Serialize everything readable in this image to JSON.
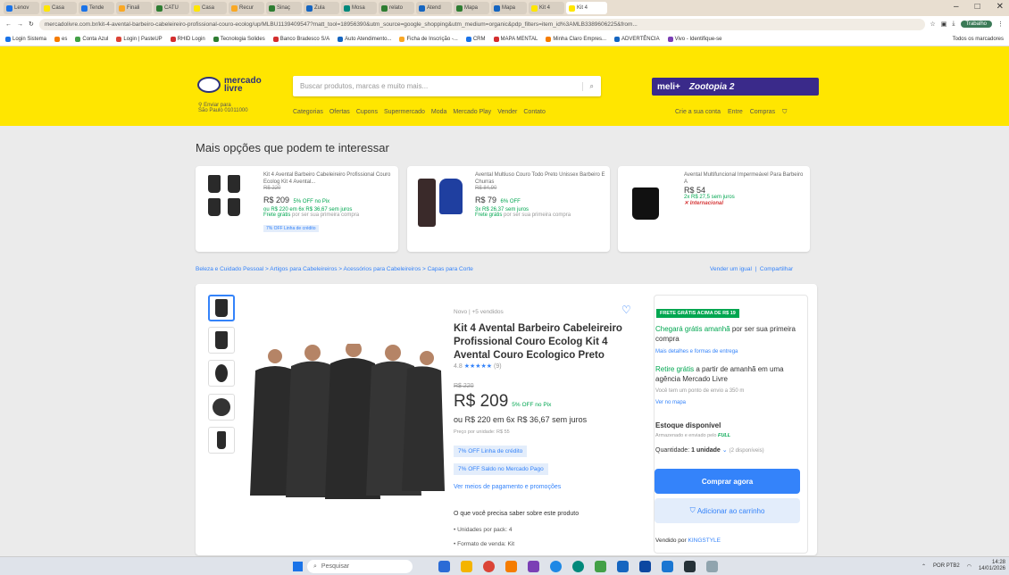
{
  "browser": {
    "tabs": [
      {
        "label": "Lenov",
        "color": "#1a73e8"
      },
      {
        "label": "Casa",
        "color": "#ffe600"
      },
      {
        "label": "Tende",
        "color": "#1a73e8"
      },
      {
        "label": "Finali",
        "color": "#f9a825"
      },
      {
        "label": "CATU",
        "color": "#2e7d32"
      },
      {
        "label": "Casa",
        "color": "#ffe600"
      },
      {
        "label": "Recur",
        "color": "#f9a825"
      },
      {
        "label": "Sinaç",
        "color": "#2e7d32"
      },
      {
        "label": "Zula",
        "color": "#1565c0"
      },
      {
        "label": "Mosa",
        "color": "#00897b"
      },
      {
        "label": "relato",
        "color": "#2e7d32"
      },
      {
        "label": "Atend",
        "color": "#1565c0"
      },
      {
        "label": "Mapa",
        "color": "#2e7d32"
      },
      {
        "label": "Mapa",
        "color": "#1565c0"
      },
      {
        "label": "Kit 4",
        "color": "#ffe600"
      },
      {
        "label": "Kit 4",
        "color": "#ffe600"
      }
    ],
    "url": "mercadolivre.com.br/kit-4-avental-barbeiro-cabeleireiro-profissional-couro-ecolog/up/MLBU1139409547?matt_tool=18956390&utm_source=google_shopping&utm_medium=organic&pdp_filters=item_id%3AMLB3389606225&from...",
    "profile": "Trabalho",
    "bookmarks": [
      "Login Sistema",
      "es",
      "Conta Azul",
      "Login | PasteUP",
      "RHID Login",
      "Tecnologia Solides",
      "Banco Bradesco S/A",
      "Auto Atendimento...",
      "Ficha de Inscrição -...",
      "CRM",
      "MAPA MENTAL",
      "Minha Claro Empres...",
      "ADVERTÊNCIA",
      "Vivo - Identifique-se"
    ],
    "all_bookmarks": "Todos os marcadores"
  },
  "header": {
    "logo_line1": "mercado",
    "logo_line2": "livre",
    "search_placeholder": "Buscar produtos, marcas e muito mais...",
    "promo_left": "meli+",
    "promo_right": "Zootopia 2",
    "ship_label": "Enviar para",
    "ship_city": "São Paulo 01011000",
    "nav": [
      "Categorias",
      "Ofertas",
      "Cupons",
      "Supermercado",
      "Moda",
      "Mercado Play",
      "Vender",
      "Contato"
    ],
    "nav_right": [
      "Crie a sua conta",
      "Entre",
      "Compras"
    ]
  },
  "more_options": {
    "title": "Mais opções que podem te interessar",
    "cards": [
      {
        "title": "Kit 4 Avental Barbeiro Cabeleireiro Profissional Couro Ecolog Kit 4 Avental...",
        "old": "R$ 220",
        "price": "R$ 209",
        "discount": "5% OFF no Pix",
        "inst": "ou R$ 220 em 6x R$ 36,67 sem juros",
        "free": "Frete grátis",
        "free_suffix": " por ser sua primeira compra",
        "badge": "7% OFF Linha de crédito"
      },
      {
        "title": "Avental Multiuso Couro Todo Preto Unissex Barbeiro E Churras",
        "old": "R$ 84,90",
        "price": "R$ 79",
        "discount": "6% OFF",
        "inst": "3x R$ 26,37 sem juros",
        "free": "Frete grátis",
        "free_suffix": " por ser sua primeira compra",
        "badge": ""
      },
      {
        "title": "Avental Multifuncional Impermeável Para Barbeiro A",
        "old": "",
        "price": "R$ 54",
        "discount": "",
        "inst": "2x R$ 27,5 sem juros",
        "free": "Internacional",
        "free_suffix": "",
        "badge": ""
      }
    ]
  },
  "breadcrumb": "Beleza e Cuidado Pessoal  >  Artigos para Cabeleireiros  >  Acessórios para Cabeleireiros  >  Capas para Corte",
  "breadcrumb_right": [
    "Vender um igual",
    "Compartilhar"
  ],
  "product": {
    "condition": "Novo  |  +5 vendidos",
    "title": "Kit 4 Avental Barbeiro Cabeleireiro Profissional Couro Ecolog Kit 4 Avental Couro Ecologico Preto",
    "rating": "4.8",
    "stars": "★★★★★",
    "reviews": "(9)",
    "old_price": "R$ 220",
    "price": "R$ 209",
    "discount": "5% OFF no Pix",
    "installments": "ou R$ 220 em 6x R$ 36,67 sem juros",
    "unit_price": "Preço por unidade: R$ 55",
    "badge1": "7% OFF Linha de crédito",
    "badge2": "7% OFF Saldo no Mercado Pago",
    "payment_link": "Ver meios de pagamento e promoções",
    "know_title": "O que você precisa saber sobre este produto",
    "bullets": [
      "Unidades por pack: 4",
      "Formato de venda: Kit"
    ]
  },
  "buybox": {
    "free_badge": "FRETE GRÁTIS ACIMA DE R$ 19",
    "arrive_green": "Chegará grátis amanhã",
    "arrive_rest": " por ser sua primeira compra",
    "more_ship": "Mais detalhes e formas de entrega",
    "pickup_green": "Retire grátis",
    "pickup_rest": " a partir de amanhã em uma agência Mercado Livre",
    "pickup_note": "Você tem um ponto de envio a 350 m",
    "map_link": "Ver no mapa",
    "stock": "Estoque disponível",
    "full": "Armazenado e enviado pelo",
    "full_badge": "FULL",
    "qty_label": "Quantidade:",
    "qty_value": "1 unidade",
    "qty_avail": "(2 disponíveis)",
    "buy": "Comprar agora",
    "cart": "Adicionar ao carrinho",
    "seller_label": "Vendido por",
    "seller": "KINGSTYLE"
  },
  "taskbar": {
    "search": "Pesquisar",
    "lang": "POR PTB2",
    "time": "14:28",
    "date": "14/01/2026"
  },
  "colors": {
    "brand": "#ffe600",
    "accent": "#3483fa",
    "green": "#00a650"
  }
}
